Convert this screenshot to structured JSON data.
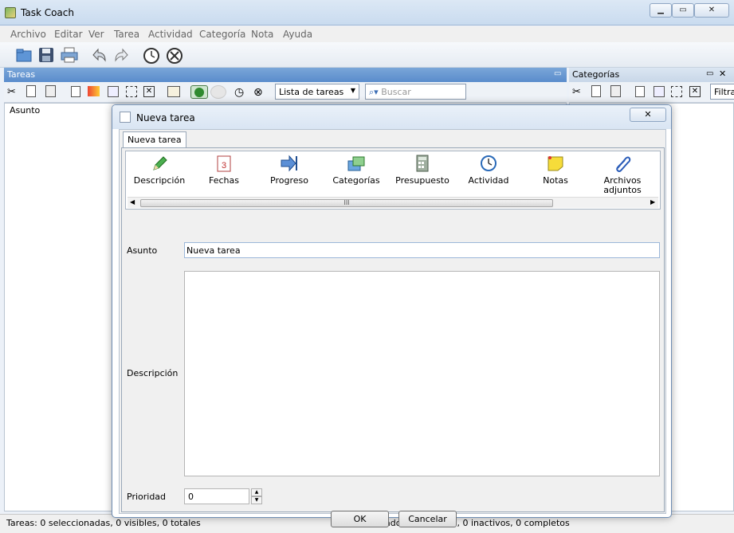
{
  "window": {
    "title": "Task Coach"
  },
  "menu": [
    "Archivo",
    "Editar",
    "Ver",
    "Tarea",
    "Actividad",
    "Categoría",
    "Nota",
    "Ayuda"
  ],
  "panels": {
    "tasks": {
      "title": "Tareas",
      "column": "Asunto",
      "view_select": "Lista de tareas",
      "search_placeholder": "Buscar"
    },
    "categories": {
      "title": "Categorías",
      "filter_label": "Filtra"
    }
  },
  "status": {
    "left": "Tareas: 0 seleccionadas, 0 visibles, 0 totales",
    "right": "Estado:  0 expiraron, 0 inactivos, 0 completos"
  },
  "dialog": {
    "title": "Nueva tarea",
    "tab": "Nueva tarea",
    "pages": [
      {
        "label": "Descripción",
        "icon": "pencil-icon",
        "color": "#3a9a3a"
      },
      {
        "label": "Fechas",
        "icon": "calendar-icon",
        "color": "#d05050"
      },
      {
        "label": "Progreso",
        "icon": "progress-arrow-icon",
        "color": "#2a5cb8"
      },
      {
        "label": "Categorías",
        "icon": "folders-icon",
        "color": "#3b8fd0"
      },
      {
        "label": "Presupuesto",
        "icon": "calculator-icon",
        "color": "#6e7e6e"
      },
      {
        "label": "Actividad",
        "icon": "clock-icon",
        "color": "#2a6ab8"
      },
      {
        "label": "Notas",
        "icon": "note-icon",
        "color": "#e8c820"
      },
      {
        "label": "Archivos adjuntos",
        "icon": "paperclip-icon",
        "color": "#2a5cb8"
      }
    ],
    "scroll_grip": "III",
    "fields": {
      "asunto_label": "Asunto",
      "asunto_value": "Nueva tarea",
      "descripcion_label": "Descripción",
      "descripcion_value": "",
      "prioridad_label": "Prioridad",
      "prioridad_value": "0"
    },
    "buttons": {
      "ok": "OK",
      "cancel": "Cancelar"
    }
  }
}
